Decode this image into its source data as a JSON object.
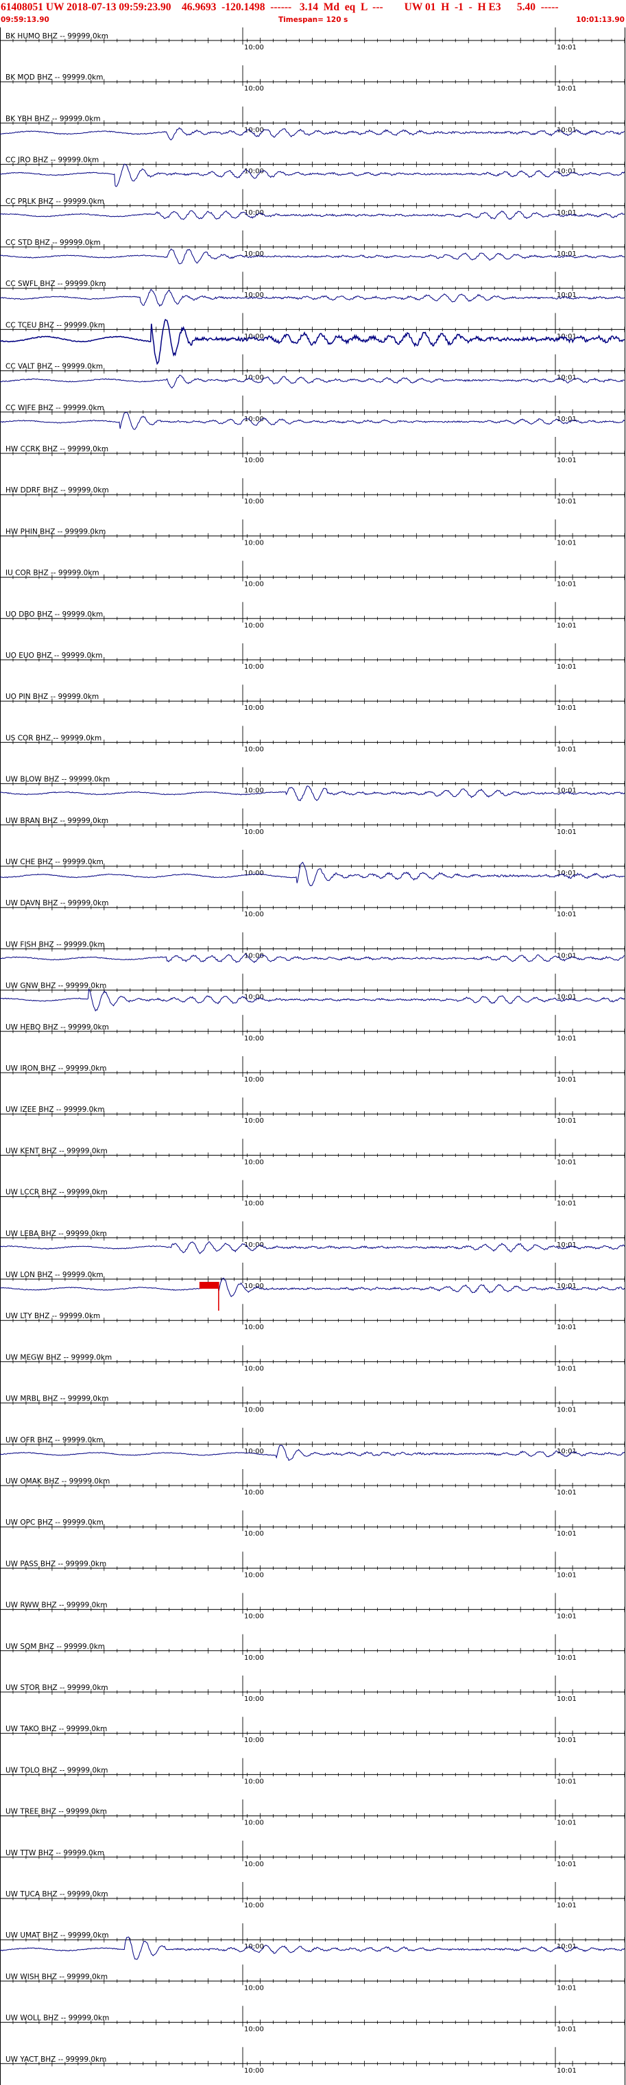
{
  "header": {
    "title": "61408051 UW 2018-07-13 09:59:23.90    46.9693  -120.1498  ------   3.14  Md  eq  L  ---        UW 01  H  -1  -  H E3      5.40  -----",
    "start_time": "09:59:13.90",
    "timespan": "Timespan= 120 s",
    "end_time": "10:01:13.90"
  },
  "colors": {
    "header_red": "#e00000",
    "trace": "#000080",
    "axis": "#000000",
    "pick": "#e00000"
  },
  "chart_data": {
    "type": "seismogram",
    "time_ticks": [
      "10:00",
      "10:01"
    ],
    "traces": [
      {
        "label": "BK HUMO BHZ -- 99999.0km",
        "active": false
      },
      {
        "label": "BK MOD BHZ -- 99999.0km",
        "active": false
      },
      {
        "label": "BK YBH BHZ -- 99999.0km",
        "active": true,
        "onset_s": 32,
        "amp": 0.9
      },
      {
        "label": "CC JRO BHZ -- 99999.0km",
        "active": true,
        "onset_s": 22,
        "amp": 0.8
      },
      {
        "label": "CC PRLK BHZ -- 99999.0km",
        "active": true,
        "onset_s": 30,
        "amp": 0.8
      },
      {
        "label": "CC STD BHZ -- 99999.0km",
        "active": true,
        "onset_s": 32,
        "amp": 0.7
      },
      {
        "label": "CC SWFL BHZ -- 99999.0km",
        "active": true,
        "onset_s": 27,
        "amp": 0.8
      },
      {
        "label": "CC TCEU BHZ -- 99999.0km",
        "active": true,
        "onset_s": 29,
        "amp": 1.6
      },
      {
        "label": "CC VALT BHZ -- 99999.0km",
        "active": true,
        "onset_s": 32,
        "amp": 0.8
      },
      {
        "label": "CC WIFE BHZ -- 99999.0km",
        "active": true,
        "onset_s": 23,
        "amp": 0.7
      },
      {
        "label": "HW CCRK BHZ -- 99999.0km",
        "active": false
      },
      {
        "label": "HW DDRF BHZ -- 99999.0km",
        "active": false
      },
      {
        "label": "HW PHIN BHZ -- 99999.0km",
        "active": false
      },
      {
        "label": "IU COR BHZ -- 99999.0km",
        "active": false
      },
      {
        "label": "UO DBO BHZ -- 99999.0km",
        "active": false
      },
      {
        "label": "UO EUO BHZ -- 99999.0km",
        "active": false
      },
      {
        "label": "UO PIN BHZ -- 99999.0km",
        "active": false
      },
      {
        "label": "US COR BHZ -- 99999.0km",
        "active": false
      },
      {
        "label": "UW BLOW BHZ -- 99999.0km",
        "active": true,
        "onset_s": 55,
        "amp": 0.8
      },
      {
        "label": "UW BRAN BHZ -- 99999.0km",
        "active": false
      },
      {
        "label": "UW CHE BHZ -- 99999.0km",
        "active": true,
        "onset_s": 57,
        "amp": 1.0
      },
      {
        "label": "UW DAVN BHZ -- 99999.0km",
        "active": false
      },
      {
        "label": "UW FISH BHZ -- 99999.0km",
        "active": true,
        "onset_s": 32,
        "amp": 0.8
      },
      {
        "label": "UW GNW BHZ -- 99999.0km",
        "active": true,
        "onset_s": 17,
        "amp": 0.8
      },
      {
        "label": "UW HEBO BHZ -- 99999.0km",
        "active": false
      },
      {
        "label": "UW IRON BHZ -- 99999.0km",
        "active": false
      },
      {
        "label": "UW IZEE BHZ -- 99999.0km",
        "active": false
      },
      {
        "label": "UW KENT BHZ -- 99999.0km",
        "active": false
      },
      {
        "label": "UW LCCR BHZ -- 99999.0km",
        "active": false
      },
      {
        "label": "UW LEBA BHZ -- 99999.0km",
        "active": true,
        "onset_s": 33,
        "amp": 0.8
      },
      {
        "label": "UW LON BHZ -- 99999.0km",
        "active": true,
        "onset_s": 42,
        "amp": 0.8
      },
      {
        "label": "UW LTY BHZ -- 99999.0km",
        "active": false
      },
      {
        "label": "UW MEGW BHZ -- 99999.0km",
        "active": false
      },
      {
        "label": "UW MRBL BHZ -- 99999.0km",
        "active": false
      },
      {
        "label": "UW OFR BHZ -- 99999.0km",
        "active": true,
        "onset_s": 53,
        "amp": 0.8
      },
      {
        "label": "UW OMAK BHZ -- 99999.0km",
        "active": false
      },
      {
        "label": "UW OPC BHZ -- 99999.0km",
        "active": false
      },
      {
        "label": "UW PASS BHZ -- 99999.0km",
        "active": false
      },
      {
        "label": "UW RWW BHZ -- 99999.0km",
        "active": false
      },
      {
        "label": "UW SQM BHZ -- 99999.0km",
        "active": false
      },
      {
        "label": "UW STOR BHZ -- 99999.0km",
        "active": false
      },
      {
        "label": "UW TAKO BHZ -- 99999.0km",
        "active": false
      },
      {
        "label": "UW TOLO BHZ -- 99999.0km",
        "active": false
      },
      {
        "label": "UW TREE BHZ -- 99999.0km",
        "active": false
      },
      {
        "label": "UW TTW BHZ -- 99999.0km",
        "active": false
      },
      {
        "label": "UW TUCA BHZ -- 99999.0km",
        "active": false
      },
      {
        "label": "UW UMAT BHZ -- 99999.0km",
        "active": true,
        "onset_s": 24,
        "amp": 0.8
      },
      {
        "label": "UW WISH BHZ -- 99999.0km",
        "active": false
      },
      {
        "label": "UW WOLL BHZ -- 99999.0km",
        "active": false
      },
      {
        "label": "UW YACT BHZ -- 99999.0km",
        "active": false
      }
    ]
  }
}
